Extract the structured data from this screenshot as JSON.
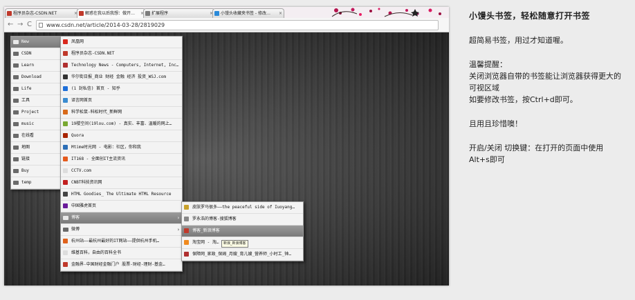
{
  "browser": {
    "tabs": [
      {
        "label": "程序员杂志-CSDN.NET",
        "active": false
      },
      {
        "label": "解惑在我以后我想：做开…",
        "active": true
      },
      {
        "label": "扩展程序",
        "active": false
      },
      {
        "label": "小馒头收藏夹书签 - 修改…",
        "active": false
      }
    ],
    "tab_close": "×",
    "address": "www.csdn.net/article/2014-03-28/2819029",
    "nav": {
      "back": "←",
      "forward": "→",
      "reload": "C"
    }
  },
  "menu_main": [
    {
      "label": "New",
      "type": "folder",
      "selected": true
    },
    {
      "label": "CSDN",
      "type": "folder"
    },
    {
      "label": "Learn",
      "type": "folder"
    },
    {
      "label": "Download",
      "type": "folder"
    },
    {
      "label": "Life",
      "type": "folder"
    },
    {
      "label": "工具",
      "type": "folder"
    },
    {
      "label": "Project",
      "type": "folder"
    },
    {
      "label": "music",
      "type": "folder"
    },
    {
      "label": "在线看",
      "type": "folder"
    },
    {
      "label": "地图",
      "type": "folder"
    },
    {
      "label": "链接",
      "type": "folder"
    },
    {
      "label": "Buy",
      "type": "folder"
    },
    {
      "label": "temp",
      "type": "folder"
    }
  ],
  "menu_new": [
    {
      "label": "凤凰网",
      "type": "link",
      "color": "#d9281d"
    },
    {
      "label": "程序员杂志-CSDN.NET",
      "type": "link",
      "color": "#c0392b"
    },
    {
      "label": "Technology News - Computers, Internet, Inc…",
      "type": "link",
      "color": "#b03030"
    },
    {
      "label": "华尔街日报_商业 财经 金融 经济 投资_WSJ.com",
      "type": "link",
      "color": "#333333"
    },
    {
      "label": "(1 封私信) 首页 - 知乎",
      "type": "link",
      "color": "#1e6fd9"
    },
    {
      "label": "译言网首页",
      "type": "link",
      "color": "#3a8bd0"
    },
    {
      "label": "科学松鼠-科松时代_新鲜网",
      "type": "link",
      "color": "#d86a1a"
    },
    {
      "label": "19楼空间(19lou.com) - 真实、丰富、温暖的网上…",
      "type": "link",
      "color": "#79a832"
    },
    {
      "label": "Quora",
      "type": "link",
      "color": "#a82400"
    },
    {
      "label": "Mtime时光网 - 电影：社区，你和我",
      "type": "link",
      "color": "#2d6fb7"
    },
    {
      "label": "IT168 - 全面创IT主流资讯",
      "type": "link",
      "color": "#e55a1c"
    },
    {
      "label": "CCTV.com",
      "type": "link",
      "color": "#dddddd"
    },
    {
      "label": "CNBT科技资讯网",
      "type": "link",
      "color": "#c21f1f"
    },
    {
      "label": "HTML Goodies_ The Ultimate HTML Resource",
      "type": "link",
      "color": "#444444"
    },
    {
      "label": "中国雅虎首页",
      "type": "link",
      "color": "#6a1b9a"
    },
    {
      "label": "博客",
      "type": "folder",
      "selected": true
    },
    {
      "label": "微博",
      "type": "folder"
    },
    {
      "label": "杭州站——最杭州最好的IT网站——提供杭州手机…",
      "type": "link",
      "color": "#e0621c"
    },
    {
      "label": "维基百科，自由的百科全书",
      "type": "link",
      "color": "#dddddd"
    },
    {
      "label": "金融界-中国财经金融门户 股票-财经-理财-基金…",
      "type": "link",
      "color": "#c0392b"
    }
  ],
  "menu_blog": [
    {
      "label": "皮肤罗马很多——the peaceful side of Iuoyang…",
      "type": "link",
      "color": "#c9a22c",
      "selected": false
    },
    {
      "label": "罗永浩的博客-搜狐博客",
      "type": "link",
      "color": "#888888",
      "selected": false
    },
    {
      "label": "博客_新浪博客",
      "type": "link",
      "color": "#c0392b",
      "selected": true
    },
    {
      "label": "淘宝网 - 淘…",
      "type": "link",
      "color": "#f08a1e",
      "selected": false
    },
    {
      "label": "保障网_家政_保姆_月嫂_育儿嫂_营养师_小时工_钟…",
      "type": "link",
      "color": "#b03030",
      "selected": false
    }
  ],
  "tooltip": "新浪_新浪博客",
  "submenu_arrow": "›",
  "description": {
    "title": "小馒头书签，轻松随意打开书签",
    "intro": "超简易书签，用过才知道喔。",
    "tip_heading": "温馨提醒：",
    "tip_line1": "关闭浏览器自带的书签能让浏览器获得更大的",
    "tip_line2": "可视区域",
    "tip_line3": "如要修改书签，按Ctrl+d即可。",
    "cherish": "且用且珍惜噢！",
    "hotkey_line1": "开启/关闭 切换键：在打开的页面中使用",
    "hotkey_line2": "Alt+s即可"
  }
}
